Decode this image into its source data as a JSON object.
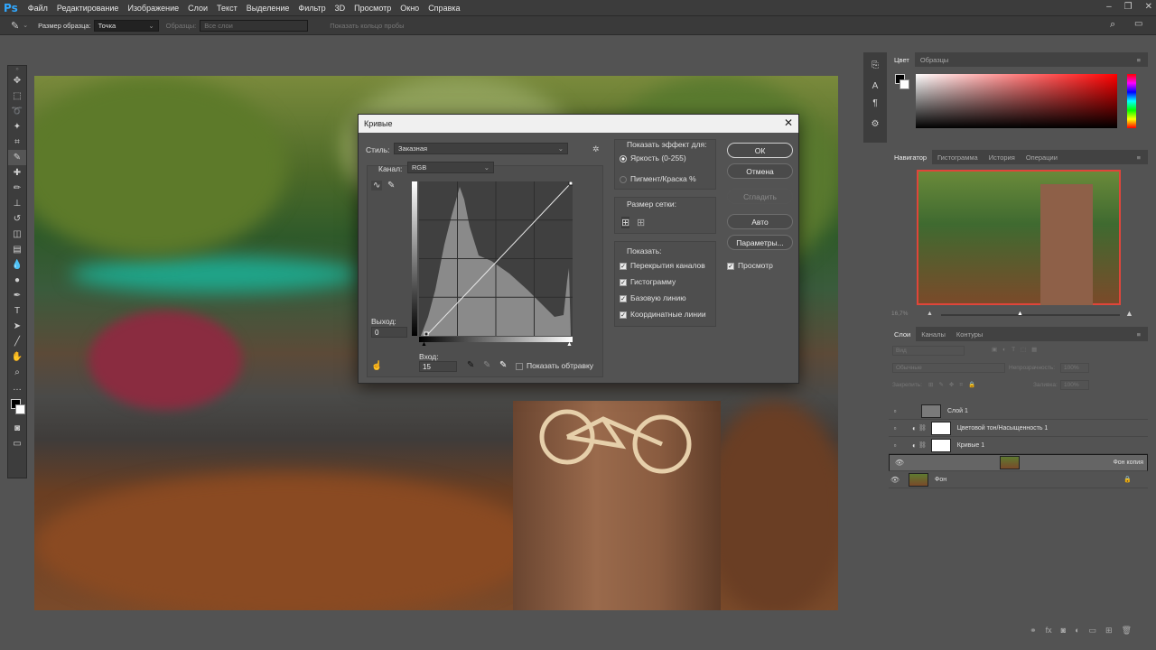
{
  "app": {
    "logo": "Ps"
  },
  "menu": [
    "Файл",
    "Редактирование",
    "Изображение",
    "Слои",
    "Текст",
    "Выделение",
    "Фильтр",
    "3D",
    "Просмотр",
    "Окно",
    "Справка"
  ],
  "options_bar": {
    "sample_size_label": "Размер образца:",
    "sample_size_value": "Точка",
    "samples_label": "Образцы:",
    "samples_value": "Все слои",
    "show_ring_label": "Показать кольцо пробы"
  },
  "curves_dialog": {
    "title": "Кривые",
    "style_label": "Стиль:",
    "style_value": "Заказная",
    "channel_label": "Канал:",
    "channel_value": "RGB",
    "output_label": "Выход:",
    "output_value": "0",
    "input_label": "Вход:",
    "input_value": "15",
    "show_clipping_label": "Показать обтравку",
    "show_effect_label": "Показать эффект для:",
    "light_label": "Яркость (0-255)",
    "pigment_label": "Пигмент/Краска %",
    "grid_size_label": "Размер сетки:",
    "show_label": "Показать:",
    "show_options": [
      "Перекрытия каналов",
      "Гистограмму",
      "Базовую линию",
      "Координатные линии"
    ],
    "buttons": {
      "ok": "ОК",
      "cancel": "Отмена",
      "smooth": "Сгладить",
      "auto": "Авто",
      "options": "Параметры..."
    },
    "preview_label": "Просмотр"
  },
  "color_panel": {
    "tabs": [
      "Цвет",
      "Образцы"
    ]
  },
  "navigator_panel": {
    "tabs": [
      "Навигатор",
      "Гистограмма",
      "История",
      "Операции"
    ],
    "zoom": "16,7%"
  },
  "layers_panel": {
    "tabs": [
      "Слои",
      "Каналы",
      "Контуры"
    ],
    "kind_label": "Вид",
    "blend_mode": "Обычные",
    "opacity_label": "Непрозрачность:",
    "opacity_value": "100%",
    "lock_label": "Закрепить:",
    "fill_label": "Заливка:",
    "fill_value": "100%",
    "layers": [
      {
        "name": "Слой 1",
        "visible": false,
        "selected": false
      },
      {
        "name": "Цветовой тон/Насыщенность 1",
        "visible": false,
        "selected": false
      },
      {
        "name": "Кривые 1",
        "visible": false,
        "selected": false
      },
      {
        "name": "Фон копия",
        "visible": true,
        "selected": true
      },
      {
        "name": "Фон",
        "visible": true,
        "selected": false
      }
    ]
  },
  "colors": {
    "accent": "#31a8ff",
    "panel_bg": "#535353",
    "dark_bg": "#3c3c3c"
  }
}
